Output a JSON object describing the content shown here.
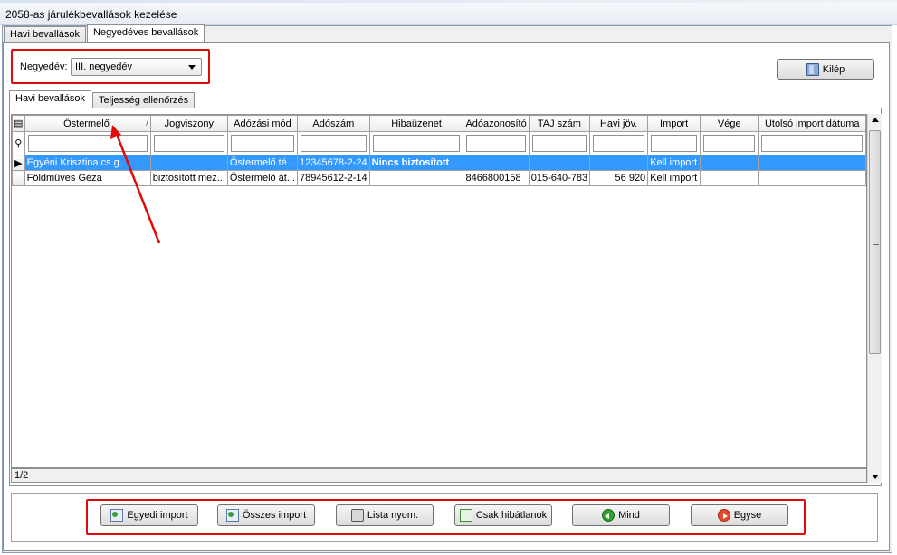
{
  "window": {
    "title": "2058-as járulékbevallások kezelése"
  },
  "top_tabs": [
    {
      "label": "Havi bevallások",
      "active": false
    },
    {
      "label": "Negyedéves bevallások",
      "active": true
    }
  ],
  "quarter": {
    "label": "Negyedév:",
    "selected": "III. negyedév"
  },
  "exit_button": {
    "label": "Kilép",
    "icon": "door-exit-icon"
  },
  "inner_tabs": [
    {
      "label": "Havi bevallások",
      "active": true
    },
    {
      "label": "Teljesség ellenőrzés",
      "active": false
    }
  ],
  "grid": {
    "columns": [
      "Östermelő",
      "Jogviszony",
      "Adózási mód",
      "Adószám",
      "Hibaüzenet",
      "Adóazonosító",
      "TAJ szám",
      "Havi jöv.",
      "Import",
      "Vége",
      "Utolsó import dátuma"
    ],
    "rows": [
      [
        "Egyéni Krisztina cs.g.",
        "",
        "Östermelő té...",
        "12345678-2-24",
        "Nincs biztosított",
        "",
        "",
        "",
        "Kell import",
        "",
        ""
      ],
      [
        "Földműves Géza",
        "biztosított mez...",
        "Östermelő át...",
        "78945612-2-14",
        "",
        "8466800158",
        "015-640-783",
        "56 920",
        "Kell import",
        "",
        ""
      ]
    ],
    "record_counter": "1/2"
  },
  "bottom_buttons": [
    {
      "label": "Egyedi import",
      "icon": "import-icon"
    },
    {
      "label": "Összes import",
      "icon": "import-all-icon"
    },
    {
      "label": "Lista nyom.",
      "icon": "printer-icon"
    },
    {
      "label": "Csak hibátlanok",
      "icon": "refresh-icon"
    },
    {
      "label": "Mind",
      "icon": "green-arrow-left-icon"
    },
    {
      "label": "Egyse",
      "icon": "red-arrow-right-icon"
    }
  ],
  "colors": {
    "selection": "#3399ff",
    "highlight": "#e00a0a"
  }
}
